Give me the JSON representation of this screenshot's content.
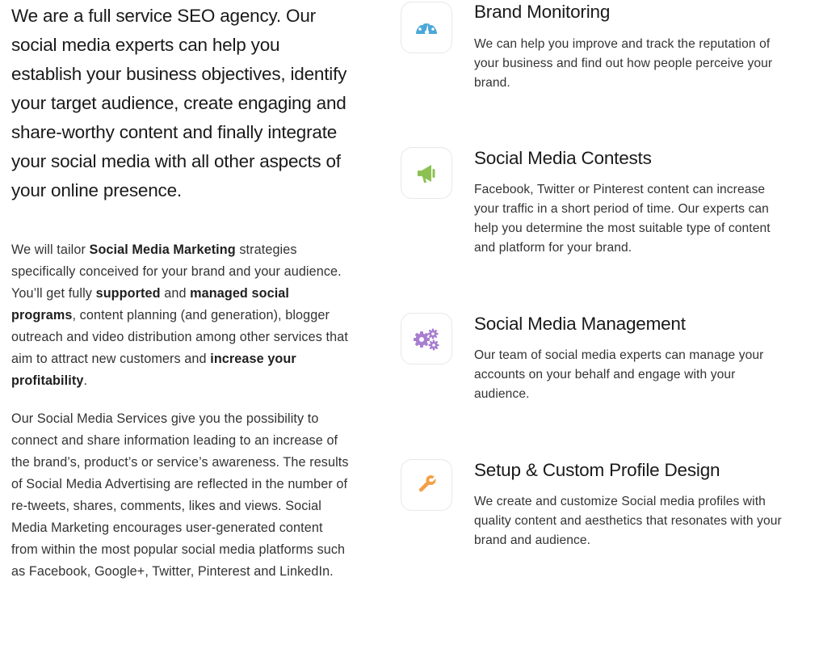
{
  "intro": {
    "lead": "We are a full service SEO agency. Our social media experts can help you establish your business objectives, identify your target audience, create engaging and share-worthy content and finally integrate your social media with all other aspects of your online presence.",
    "para1": {
      "t1": "We will tailor ",
      "b1": "Social Media Marketing",
      "t2": " strategies specifically conceived for your brand and your audience. You’ll get fully ",
      "b2": "supported",
      "t3": " and ",
      "b3": "managed social programs",
      "t4": ", content planning (and generation), blogger outreach and video distribution among other services that aim to attract new customers and ",
      "b4": "increase your profitability",
      "t5": "."
    },
    "para2": "Our Social Media Services give you the possibility to connect and share information leading to an increase of the brand’s, product’s or service’s awareness. The results of Social Media Advertising are reflected in the number of re-tweets, shares, comments, likes and views. Social Media Marketing encourages user-generated content from within the most popular social media platforms such as Facebook, Google+, Twitter, Pinterest and LinkedIn."
  },
  "services": [
    {
      "title": "Brand Monitoring",
      "description": "We can help you improve and track the reputation of your business and find out how people perceive your brand.",
      "icon": "speedometer-icon",
      "icon_color": "#4aa8d8"
    },
    {
      "title": "Social Media Contests",
      "description": "Facebook, Twitter or Pinterest content can increase your traffic in a short period of time. Our experts can help you determine the most suitable type of content and platform for your brand.",
      "icon": "megaphone-icon",
      "icon_color": "#8cc152"
    },
    {
      "title": "Social Media Management",
      "description": "Our team of social media experts can manage your accounts on your behalf and engage with your audience.",
      "icon": "gears-icon",
      "icon_color": "#a77ed0"
    },
    {
      "title": "Setup & Custom Profile Design",
      "description": "We create and customize Social media profiles with quality content and aesthetics that resonates with your brand and audience.",
      "icon": "wrench-icon",
      "icon_color": "#f2a047"
    }
  ]
}
